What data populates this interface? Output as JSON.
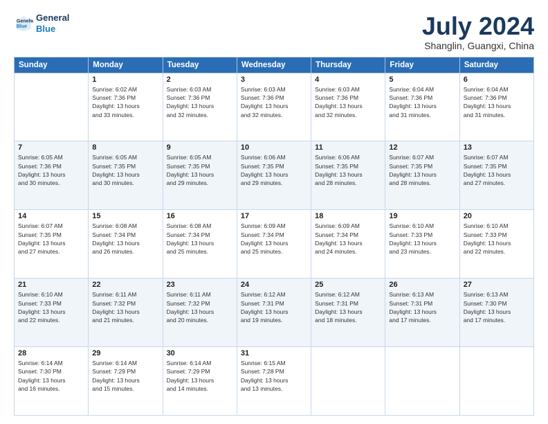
{
  "logo": {
    "line1": "General",
    "line2": "Blue"
  },
  "title": "July 2024",
  "location": "Shanglin, Guangxi, China",
  "days_of_week": [
    "Sunday",
    "Monday",
    "Tuesday",
    "Wednesday",
    "Thursday",
    "Friday",
    "Saturday"
  ],
  "weeks": [
    [
      {
        "day": "",
        "info": ""
      },
      {
        "day": "1",
        "info": "Sunrise: 6:02 AM\nSunset: 7:36 PM\nDaylight: 13 hours\nand 33 minutes."
      },
      {
        "day": "2",
        "info": "Sunrise: 6:03 AM\nSunset: 7:36 PM\nDaylight: 13 hours\nand 32 minutes."
      },
      {
        "day": "3",
        "info": "Sunrise: 6:03 AM\nSunset: 7:36 PM\nDaylight: 13 hours\nand 32 minutes."
      },
      {
        "day": "4",
        "info": "Sunrise: 6:03 AM\nSunset: 7:36 PM\nDaylight: 13 hours\nand 32 minutes."
      },
      {
        "day": "5",
        "info": "Sunrise: 6:04 AM\nSunset: 7:36 PM\nDaylight: 13 hours\nand 31 minutes."
      },
      {
        "day": "6",
        "info": "Sunrise: 6:04 AM\nSunset: 7:36 PM\nDaylight: 13 hours\nand 31 minutes."
      }
    ],
    [
      {
        "day": "7",
        "info": "Sunrise: 6:05 AM\nSunset: 7:36 PM\nDaylight: 13 hours\nand 30 minutes."
      },
      {
        "day": "8",
        "info": "Sunrise: 6:05 AM\nSunset: 7:35 PM\nDaylight: 13 hours\nand 30 minutes."
      },
      {
        "day": "9",
        "info": "Sunrise: 6:05 AM\nSunset: 7:35 PM\nDaylight: 13 hours\nand 29 minutes."
      },
      {
        "day": "10",
        "info": "Sunrise: 6:06 AM\nSunset: 7:35 PM\nDaylight: 13 hours\nand 29 minutes."
      },
      {
        "day": "11",
        "info": "Sunrise: 6:06 AM\nSunset: 7:35 PM\nDaylight: 13 hours\nand 28 minutes."
      },
      {
        "day": "12",
        "info": "Sunrise: 6:07 AM\nSunset: 7:35 PM\nDaylight: 13 hours\nand 28 minutes."
      },
      {
        "day": "13",
        "info": "Sunrise: 6:07 AM\nSunset: 7:35 PM\nDaylight: 13 hours\nand 27 minutes."
      }
    ],
    [
      {
        "day": "14",
        "info": "Sunrise: 6:07 AM\nSunset: 7:35 PM\nDaylight: 13 hours\nand 27 minutes."
      },
      {
        "day": "15",
        "info": "Sunrise: 6:08 AM\nSunset: 7:34 PM\nDaylight: 13 hours\nand 26 minutes."
      },
      {
        "day": "16",
        "info": "Sunrise: 6:08 AM\nSunset: 7:34 PM\nDaylight: 13 hours\nand 25 minutes."
      },
      {
        "day": "17",
        "info": "Sunrise: 6:09 AM\nSunset: 7:34 PM\nDaylight: 13 hours\nand 25 minutes."
      },
      {
        "day": "18",
        "info": "Sunrise: 6:09 AM\nSunset: 7:34 PM\nDaylight: 13 hours\nand 24 minutes."
      },
      {
        "day": "19",
        "info": "Sunrise: 6:10 AM\nSunset: 7:33 PM\nDaylight: 13 hours\nand 23 minutes."
      },
      {
        "day": "20",
        "info": "Sunrise: 6:10 AM\nSunset: 7:33 PM\nDaylight: 13 hours\nand 22 minutes."
      }
    ],
    [
      {
        "day": "21",
        "info": "Sunrise: 6:10 AM\nSunset: 7:33 PM\nDaylight: 13 hours\nand 22 minutes."
      },
      {
        "day": "22",
        "info": "Sunrise: 6:11 AM\nSunset: 7:32 PM\nDaylight: 13 hours\nand 21 minutes."
      },
      {
        "day": "23",
        "info": "Sunrise: 6:11 AM\nSunset: 7:32 PM\nDaylight: 13 hours\nand 20 minutes."
      },
      {
        "day": "24",
        "info": "Sunrise: 6:12 AM\nSunset: 7:31 PM\nDaylight: 13 hours\nand 19 minutes."
      },
      {
        "day": "25",
        "info": "Sunrise: 6:12 AM\nSunset: 7:31 PM\nDaylight: 13 hours\nand 18 minutes."
      },
      {
        "day": "26",
        "info": "Sunrise: 6:13 AM\nSunset: 7:31 PM\nDaylight: 13 hours\nand 17 minutes."
      },
      {
        "day": "27",
        "info": "Sunrise: 6:13 AM\nSunset: 7:30 PM\nDaylight: 13 hours\nand 17 minutes."
      }
    ],
    [
      {
        "day": "28",
        "info": "Sunrise: 6:14 AM\nSunset: 7:30 PM\nDaylight: 13 hours\nand 16 minutes."
      },
      {
        "day": "29",
        "info": "Sunrise: 6:14 AM\nSunset: 7:29 PM\nDaylight: 13 hours\nand 15 minutes."
      },
      {
        "day": "30",
        "info": "Sunrise: 6:14 AM\nSunset: 7:29 PM\nDaylight: 13 hours\nand 14 minutes."
      },
      {
        "day": "31",
        "info": "Sunrise: 6:15 AM\nSunset: 7:28 PM\nDaylight: 13 hours\nand 13 minutes."
      },
      {
        "day": "",
        "info": ""
      },
      {
        "day": "",
        "info": ""
      },
      {
        "day": "",
        "info": ""
      }
    ]
  ]
}
